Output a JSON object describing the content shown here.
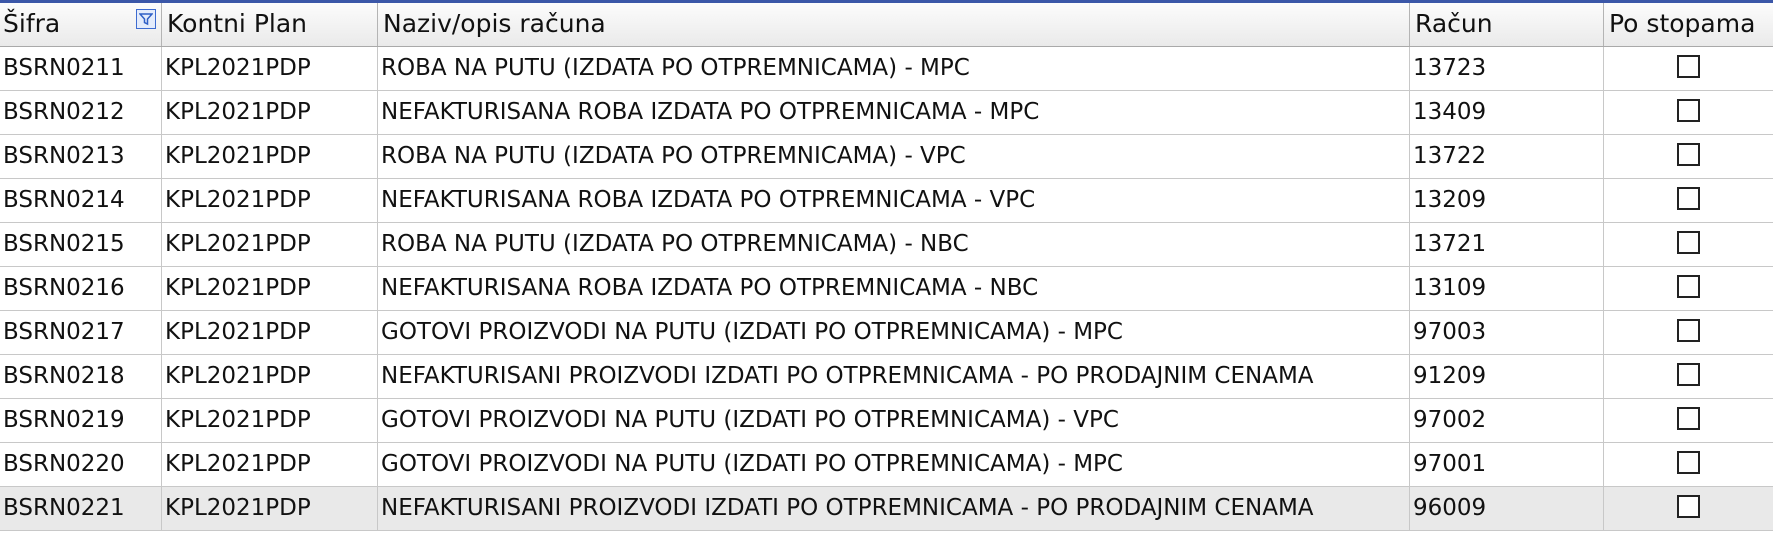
{
  "grid": {
    "columns": [
      {
        "key": "sifra",
        "label": "Šifra",
        "filter_icon": "filter-icon"
      },
      {
        "key": "kontni_plan",
        "label": "Kontni Plan"
      },
      {
        "key": "naziv",
        "label": "Naziv/opis računa"
      },
      {
        "key": "racun",
        "label": "Račun"
      },
      {
        "key": "po_stopama",
        "label": "Po stopama"
      }
    ],
    "rows": [
      {
        "sifra": "BSRN0211",
        "kontni_plan": "KPL2021PDP",
        "naziv": "ROBA NA PUTU (IZDATA PO OTPREMNICAMA) - MPC",
        "racun": "13723",
        "po_stopama": false
      },
      {
        "sifra": "BSRN0212",
        "kontni_plan": "KPL2021PDP",
        "naziv": "NEFAKTURISANA ROBA IZDATA PO OTPREMNICAMA - MPC",
        "racun": "13409",
        "po_stopama": false
      },
      {
        "sifra": "BSRN0213",
        "kontni_plan": "KPL2021PDP",
        "naziv": "ROBA NA PUTU (IZDATA PO OTPREMNICAMA) - VPC",
        "racun": "13722",
        "po_stopama": false
      },
      {
        "sifra": "BSRN0214",
        "kontni_plan": "KPL2021PDP",
        "naziv": "NEFAKTURISANA ROBA IZDATA PO OTPREMNICAMA - VPC",
        "racun": "13209",
        "po_stopama": false
      },
      {
        "sifra": "BSRN0215",
        "kontni_plan": "KPL2021PDP",
        "naziv": "ROBA NA PUTU (IZDATA PO OTPREMNICAMA) - NBC",
        "racun": "13721",
        "po_stopama": false
      },
      {
        "sifra": "BSRN0216",
        "kontni_plan": "KPL2021PDP",
        "naziv": "NEFAKTURISANA ROBA IZDATA PO OTPREMNICAMA - NBC",
        "racun": "13109",
        "po_stopama": false
      },
      {
        "sifra": "BSRN0217",
        "kontni_plan": "KPL2021PDP",
        "naziv": "GOTOVI PROIZVODI NA PUTU (IZDATI PO OTPREMNICAMA) - MPC",
        "racun": "97003",
        "po_stopama": false
      },
      {
        "sifra": "BSRN0218",
        "kontni_plan": "KPL2021PDP",
        "naziv": "NEFAKTURISANI PROIZVODI IZDATI PO OTPREMNICAMA - PO PRODAJNIM CENAMA",
        "racun": "91209",
        "po_stopama": false
      },
      {
        "sifra": "BSRN0219",
        "kontni_plan": "KPL2021PDP",
        "naziv": "GOTOVI PROIZVODI NA PUTU (IZDATI PO OTPREMNICAMA) - VPC",
        "racun": "97002",
        "po_stopama": false
      },
      {
        "sifra": "BSRN0220",
        "kontni_plan": "KPL2021PDP",
        "naziv": "GOTOVI PROIZVODI NA PUTU (IZDATI PO OTPREMNICAMA) - MPC",
        "racun": "97001",
        "po_stopama": false
      },
      {
        "sifra": "BSRN0221",
        "kontni_plan": "KPL2021PDP",
        "naziv": "NEFAKTURISANI PROIZVODI IZDATI PO OTPREMNICAMA - PO PRODAJNIM CENAMA",
        "racun": "96009",
        "po_stopama": false,
        "selected": true
      }
    ]
  },
  "colors": {
    "top_border": "#3b57a8",
    "filter_icon": "#3d6bd0",
    "selected_row": "#e9e9e9"
  }
}
